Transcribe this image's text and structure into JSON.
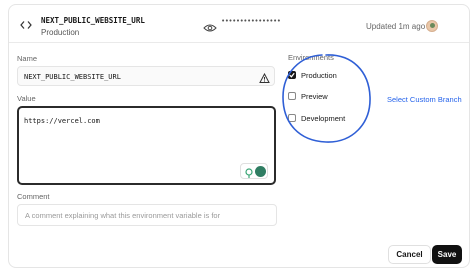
{
  "header": {
    "var_name": "NEXT_PUBLIC_WEBSITE_URL",
    "environment": "Production",
    "masked_value": "••••••••••••••••",
    "updated": "Updated 1m ago"
  },
  "form": {
    "name_label": "Name",
    "name_value": "NEXT_PUBLIC_WEBSITE_URL",
    "value_label": "Value",
    "value_text": "https://vercel.com",
    "comment_label": "Comment",
    "comment_placeholder": "A comment explaining what this environment variable is for",
    "comment_value": ""
  },
  "environments": {
    "label": "Environments",
    "items": [
      {
        "label": "Production",
        "checked": true
      },
      {
        "label": "Preview",
        "checked": false
      },
      {
        "label": "Development",
        "checked": false
      }
    ],
    "custom_branch_link": "Select Custom Branch"
  },
  "actions": {
    "cancel_label": "Cancel",
    "save_label": "Save"
  },
  "colors": {
    "link": "#2563eb",
    "annotation_circle": "#2f5fd6",
    "primary_button": "#111111"
  },
  "icons": [
    "code-icon",
    "eye-icon",
    "avatar",
    "warning-icon",
    "lightbulb-icon",
    "assistant-icon",
    "checkmark-icon"
  ]
}
